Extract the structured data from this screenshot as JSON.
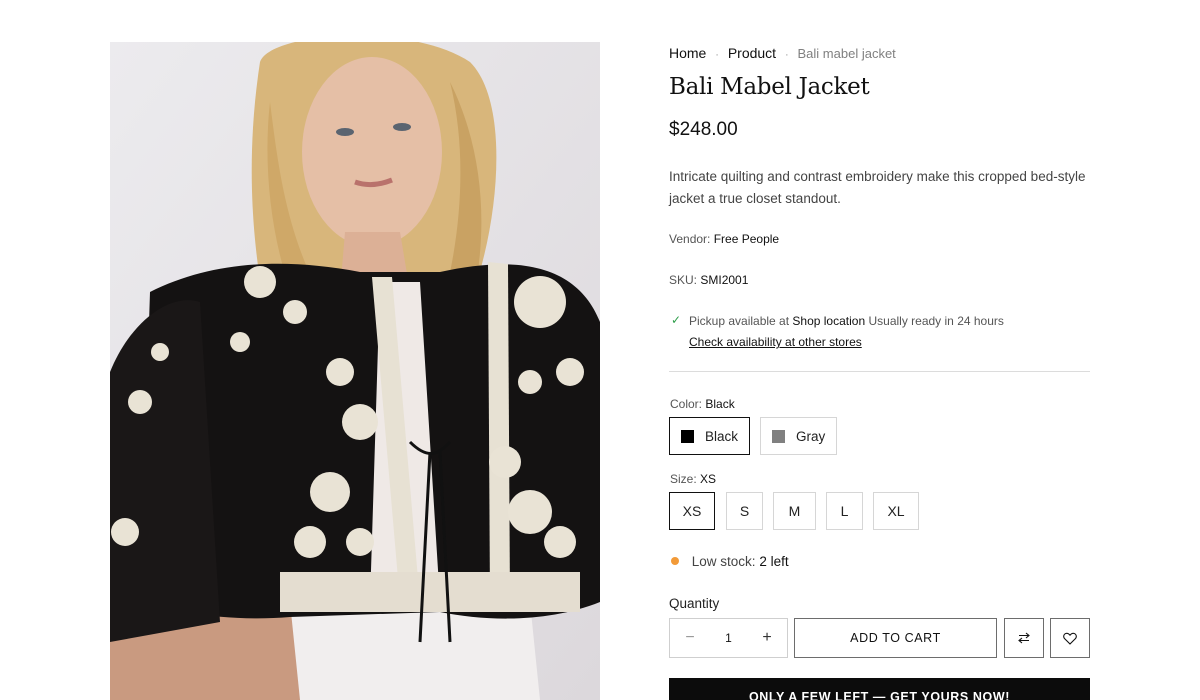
{
  "product_image": {
    "alt": "Model wearing black embroidered jacket"
  },
  "breadcrumb": {
    "home": "Home",
    "product": "Product",
    "current": "Bali mabel jacket",
    "separator": "·"
  },
  "product": {
    "title": "Bali Mabel Jacket",
    "price": "$248.00",
    "description": "Intricate quilting and contrast embroidery make this cropped bed-style jacket a true closet standout.",
    "vendor_label": "Vendor:",
    "vendor": "Free People",
    "sku_label": "SKU:",
    "sku": "SMI2001"
  },
  "pickup": {
    "prefix": "Pickup available at",
    "location": "Shop location",
    "ready": "Usually ready in 24 hours",
    "check_link": "Check availability at other stores"
  },
  "color": {
    "label": "Color:",
    "selected": "Black",
    "options": [
      {
        "name": "Black",
        "swatch": "#000000"
      },
      {
        "name": "Gray",
        "swatch": "#808080"
      }
    ]
  },
  "size": {
    "label": "Size:",
    "selected": "XS",
    "options": [
      "XS",
      "S",
      "M",
      "L",
      "XL"
    ]
  },
  "stock": {
    "label": "Low stock:",
    "value": "2 left",
    "dot_color": "#f29a38"
  },
  "quantity": {
    "label": "Quantity",
    "value": "1",
    "minus": "−",
    "plus": "+"
  },
  "actions": {
    "add_to_cart": "ADD TO CART",
    "compare_icon": "compare-arrows-icon",
    "wishlist_icon": "heart-icon"
  },
  "promo": {
    "text": "ONLY A FEW LEFT — GET YOURS NOW!"
  }
}
